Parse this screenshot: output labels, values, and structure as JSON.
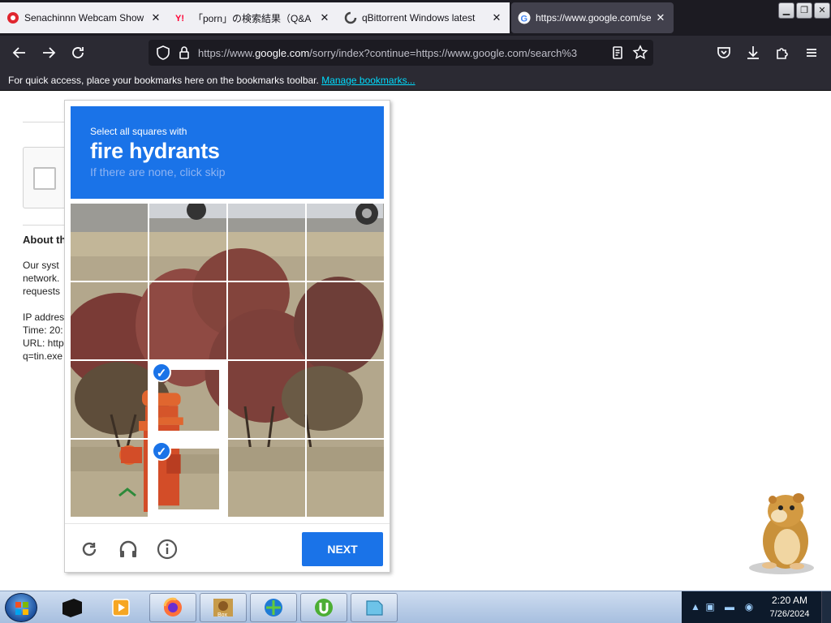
{
  "browser": {
    "tabs": [
      {
        "title": "Senachinnn Webcam Show |",
        "active": false
      },
      {
        "title": "「porn」の検索結果（Q&A",
        "active": false
      },
      {
        "title": "qBittorrent Windows latest",
        "active": false
      },
      {
        "title": "https://www.google.com/se",
        "active": true
      }
    ],
    "url_prefix": "https://www.",
    "url_domain": "google.com",
    "url_suffix": "/sorry/index?continue=https://www.google.com/search%3",
    "bookmarks_text": "For quick access, place your bookmarks here on the bookmarks toolbar.",
    "bookmarks_link": "Manage bookmarks..."
  },
  "page_bg": {
    "about_heading": "About th",
    "para_lines": [
      "Our syst",
      "network.",
      "requests"
    ],
    "info_lines": [
      "IP addres",
      "Time: 20:",
      "URL: http",
      "q=tin.exe"
    ]
  },
  "challenge": {
    "instruction": "Select all squares with",
    "target": "fire hydrants",
    "skip_hint": "If there are none, click skip",
    "selected_tiles": [
      9,
      13
    ],
    "footer": {
      "reload_icon": "reload-icon",
      "audio_icon": "headphones-icon",
      "info_icon": "info-icon",
      "next_label": "NEXT"
    },
    "colors": {
      "accent": "#1a73e8"
    }
  },
  "taskbar": {
    "clock_time": "2:20 AM",
    "clock_date": "7/26/2024"
  }
}
